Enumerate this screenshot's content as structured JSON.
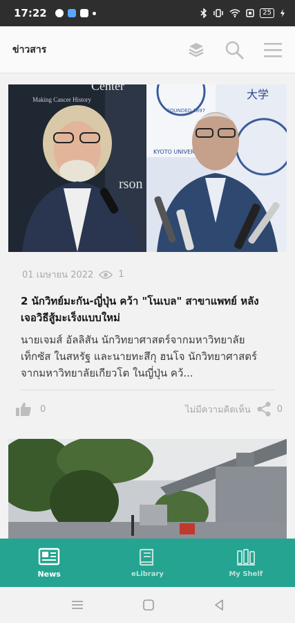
{
  "status_bar": {
    "time": "17:22",
    "battery": "25"
  },
  "header": {
    "title": "ข่าวสาร"
  },
  "articles": [
    {
      "date": "01 เมษายน 2022",
      "views": "1",
      "title": "2 นักวิทย์มะกัน-ญี่ปุ่น คว้า \"โนเบล\" สาขาแพทย์ หลังเจอวิธีสู้มะเร็งแบบใหม่",
      "excerpt": "นายเจมส์ อัลลิสัน นักวิทยาศาสตร์จากมหาวิทยาลัยเท็กซัส ในสหรัฐ และนายทะสึกุ ฮนโจ นักวิทยาศาสตร์จากมหาวิทยาลัยเกียวโต ในญี่ปุ่น คว้...",
      "likes": "0",
      "comment_label": "ไม่มีความคิดเห็น",
      "shares": "0",
      "photo_text": {
        "left_top": "Center",
        "left_sub": "Making Cancer History",
        "left_mid": "rson",
        "right_banner": "KYOTO UNIVERSITY",
        "right_top": "大学",
        "seal": "FOUNDED 1897"
      }
    },
    {}
  ],
  "tabs": [
    {
      "label": "News",
      "icon": "newspaper-icon",
      "active": true
    },
    {
      "label": "eLibrary",
      "icon": "book-icon",
      "active": false
    },
    {
      "label": "My Shelf",
      "icon": "shelf-icon",
      "active": false
    }
  ],
  "colors": {
    "accent": "#24a491",
    "statusbar": "#2e2e2e"
  }
}
